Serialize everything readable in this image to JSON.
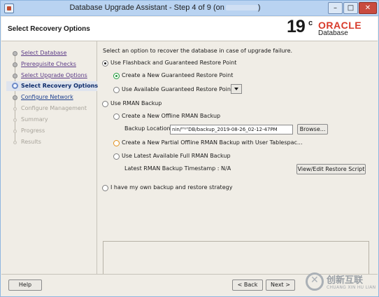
{
  "window": {
    "title": "Database Upgrade Assistant - Step 4 of 9 (on",
    "title_suffix": ")",
    "minimize_glyph": "–",
    "maximize_glyph": "□",
    "close_glyph": "✕"
  },
  "header": {
    "page_title": "Select Recovery Options",
    "brand_version": "19",
    "brand_superscript": "c",
    "brand_name": "ORACLE",
    "brand_product": "Database"
  },
  "sidebar": {
    "steps": [
      {
        "label": "Select Database",
        "state": "done"
      },
      {
        "label": "Prerequisite Checks",
        "state": "done"
      },
      {
        "label": "Select Upgrade Options",
        "state": "done"
      },
      {
        "label": "Select Recovery Options",
        "state": "current"
      },
      {
        "label": "Configure Network",
        "state": "link"
      },
      {
        "label": "Configure Management",
        "state": "todo"
      },
      {
        "label": "Summary",
        "state": "todo"
      },
      {
        "label": "Progress",
        "state": "todo"
      },
      {
        "label": "Results",
        "state": "todo"
      }
    ]
  },
  "content": {
    "intro": "Select an option to recover the database in case of upgrade failure.",
    "flashback_option": "Use Flashback and Guaranteed Restore Point",
    "create_restore_point": "Create a New Guaranteed Restore Point",
    "use_available_restore_point": "Use Available Guaranteed Restore Point",
    "rman_option": "Use RMAN Backup",
    "create_offline_rman": "Create a New Offline RMAN Backup",
    "backup_location_label": "Backup Location",
    "backup_location_value": "nin/ˡᵀᴳᵀDB/backup_2019-08-26_02-12-47PM",
    "browse_button": "Browse...",
    "create_partial_offline": "Create a New Partial Offline RMAN Backup with User Tablespac...",
    "use_latest_rman": "Use Latest Available Full RMAN Backup",
    "latest_timestamp_label": "Latest RMAN Backup Timestamp : N/A",
    "view_restore_script_button": "View/Edit Restore Script",
    "own_backup_option": "I have my own backup and restore strategy"
  },
  "footer": {
    "help_button": "Help",
    "back_button": "< Back",
    "next_button": "Next >"
  },
  "watermark": {
    "chinese": "创新互联",
    "english": "CHUANG XIN HU LIAN"
  },
  "colors": {
    "titlebar": "#b9d3f1",
    "close_button": "#c94b3f",
    "oracle_red": "#d83a2a",
    "current_step": "#0d2b6a",
    "selected_radio": "#1e9b3a"
  }
}
